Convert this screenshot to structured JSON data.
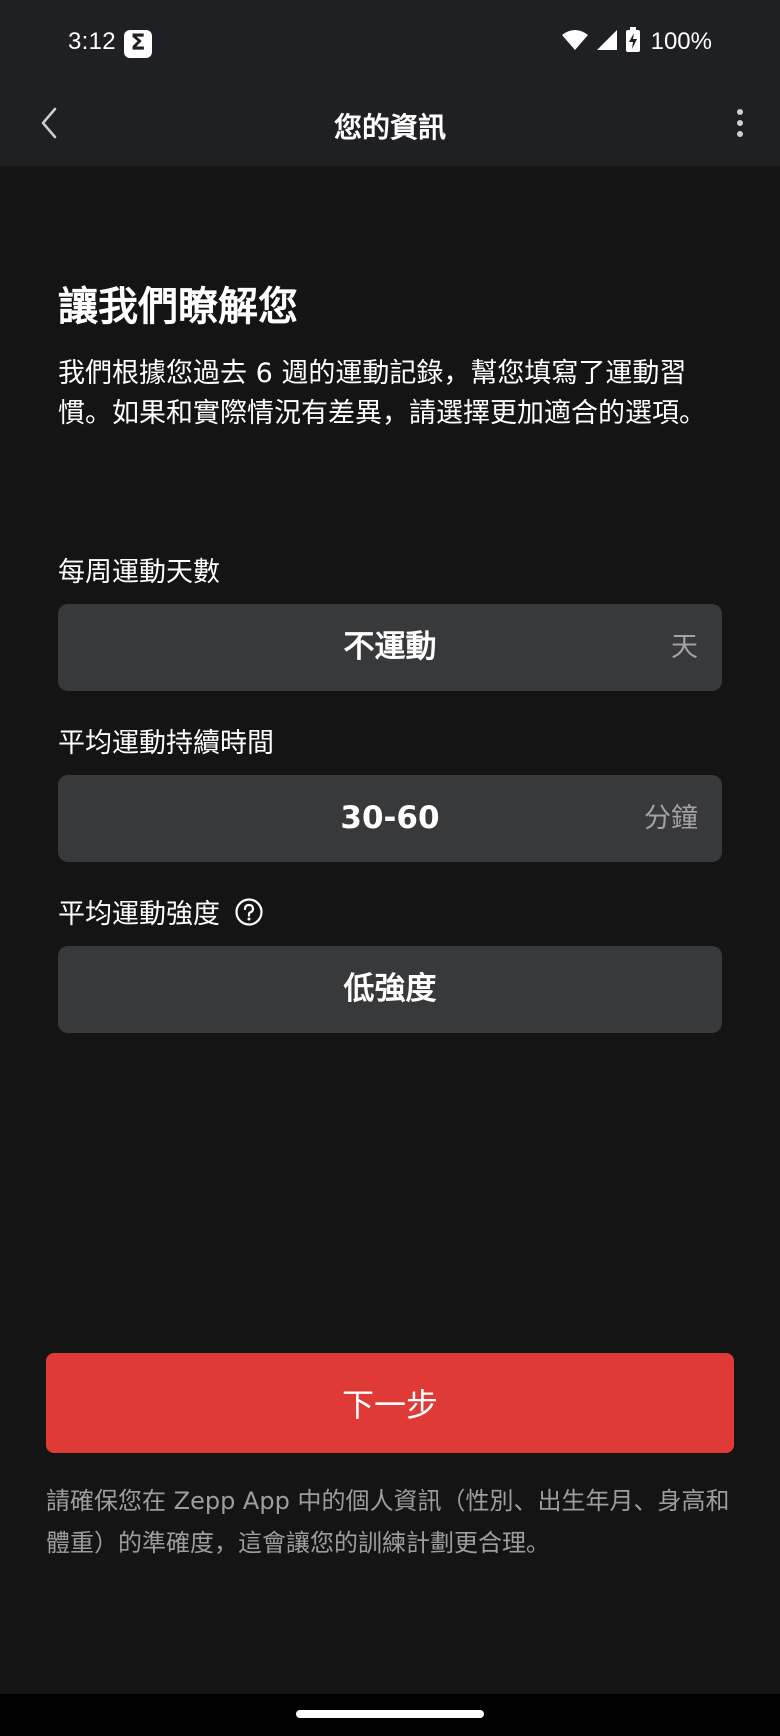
{
  "status_bar": {
    "time": "3:12",
    "app_icon_glyph": "Σ",
    "battery": "100%",
    "icons": [
      "wifi-icon",
      "signal-icon",
      "battery-charging-icon"
    ]
  },
  "app_bar": {
    "title": "您的資訊",
    "back_icon": "chevron-left-icon",
    "more_icon": "more-vertical-icon"
  },
  "main": {
    "heading": "讓我們瞭解您",
    "intro": "我們根據您過去 6 週的運動記錄，幫您填寫了運動習慣。如果和實際情況有差異，請選擇更加適合的選項。",
    "fields": [
      {
        "label": "每周運動天數",
        "value": "不運動",
        "unit": "天"
      },
      {
        "label": "平均運動持續時間",
        "value": "30-60",
        "unit": "分鐘"
      },
      {
        "label": "平均運動強度",
        "value": "低強度",
        "unit": "",
        "help_icon": "help-circle-icon"
      }
    ]
  },
  "footer": {
    "next_label": "下一步",
    "disclaimer": "請確保您在 Zepp App 中的個人資訊（性別、出生年月、身高和體重）的準確度，這會讓您的訓練計劃更合理。"
  },
  "colors": {
    "background": "#141414",
    "bar": "#1f2023",
    "field": "#38393b",
    "accent": "#e03a37",
    "muted_text": "#9d9d9f"
  }
}
